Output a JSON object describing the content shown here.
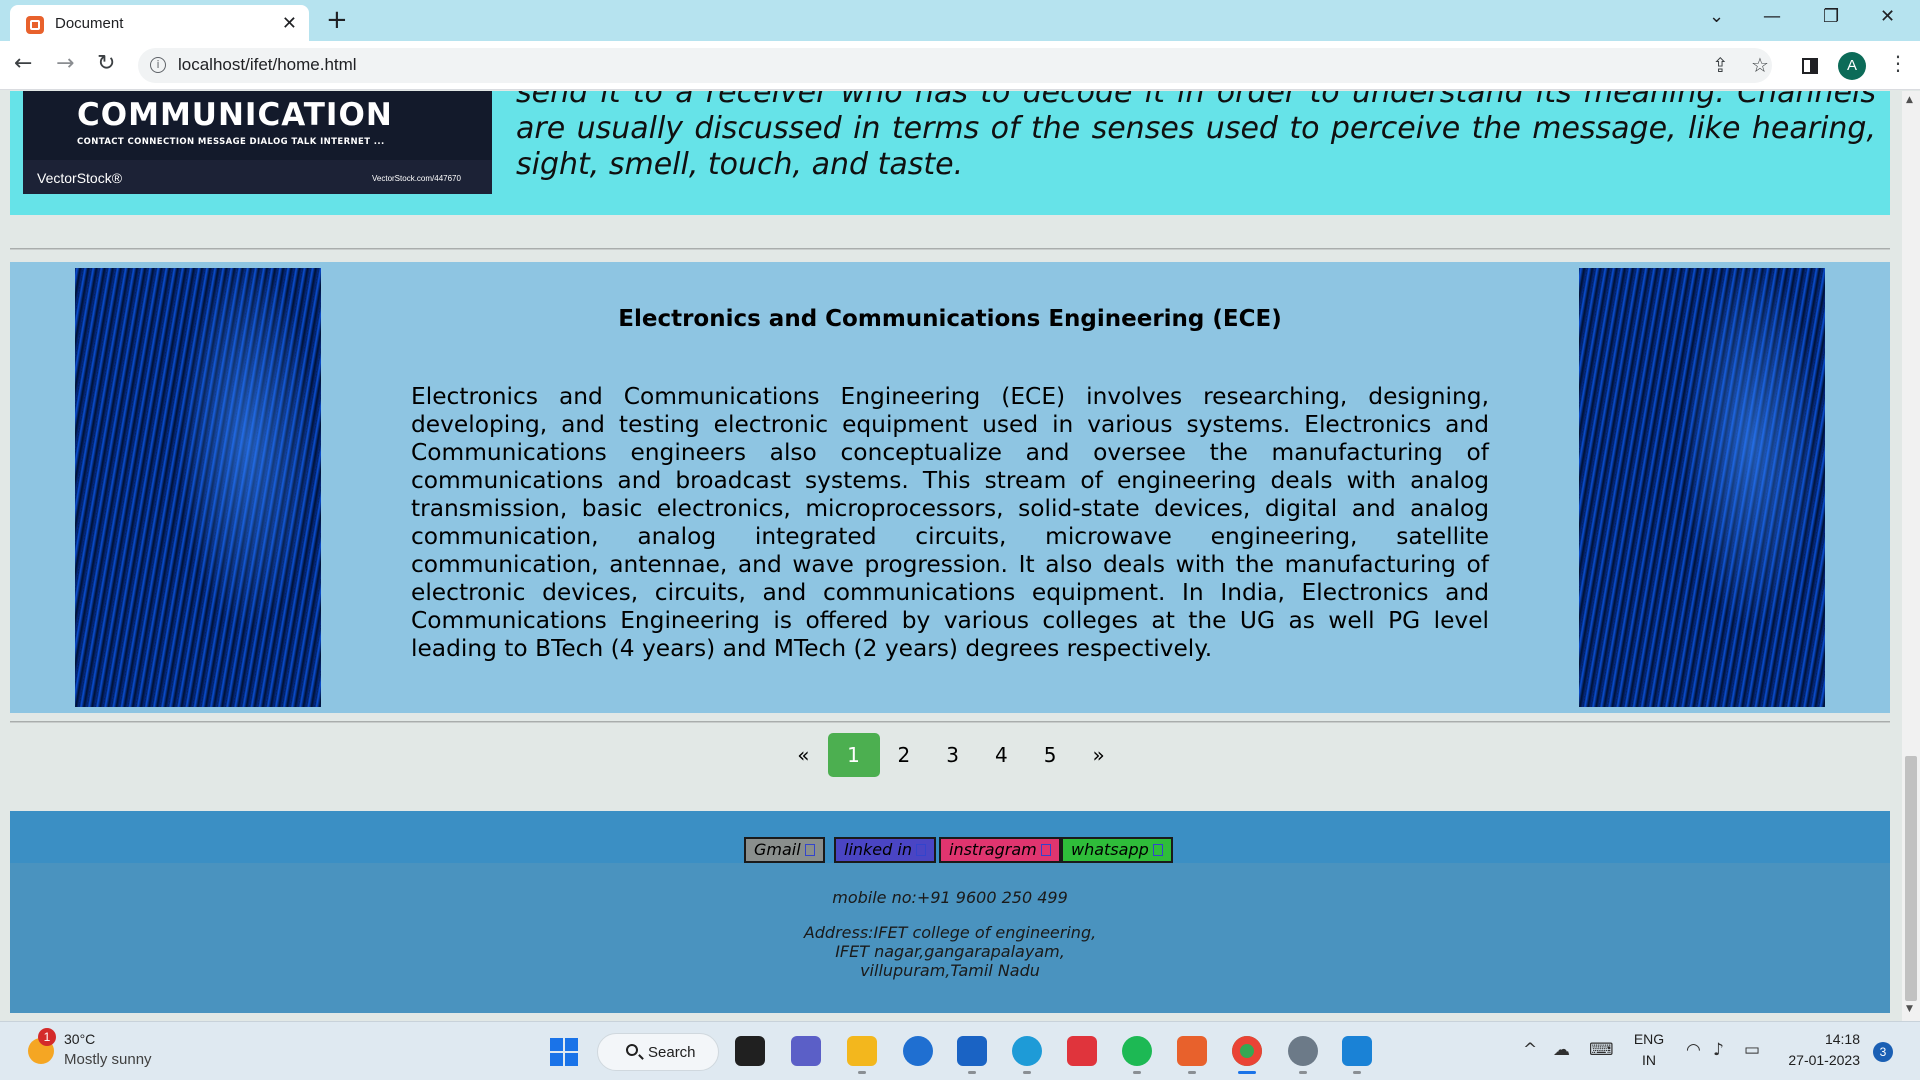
{
  "browser": {
    "tab_title": "Document",
    "tab_close": "✕",
    "new_tab": "+",
    "url": "localhost/ifet/home.html",
    "profile_initial": "A",
    "window_controls": [
      "⌄",
      "—",
      "❐",
      "✕"
    ]
  },
  "communication": {
    "image": {
      "title": "COMMUNICATION",
      "subtitle": "CONTACT  CONNECTION  MESSAGE  DIALOG  TALK  INTERNET ...",
      "brand": "VectorStock®",
      "id": "VectorStock.com/447670"
    },
    "text": "send it to a receiver who has to decode it in order to understand its meaning. Channels are usually discussed in terms of the senses used to perceive the message, like hearing, sight, smell, touch, and taste."
  },
  "ece": {
    "title": "Electronics and Communications Engineering (ECE)",
    "body": "Electronics and Communications Engineering (ECE) involves researching, designing, developing, and testing electronic equipment used in various systems. Electronics and Communications engineers also conceptualize and oversee the manufacturing of communications and broadcast systems. This stream of engineering deals with analog transmission, basic electronics, microprocessors, solid-state devices, digital and analog communication, analog integrated circuits, microwave engineering, satellite communication, antennae, and wave progression. It also deals with the manufacturing of electronic devices, circuits, and communications equipment. In India, Electronics and Communications Engineering is offered by various colleges at the UG as well PG level leading to BTech (4 years) and MTech (2 years) degrees respectively."
  },
  "pagination": {
    "prev": "«",
    "pages": [
      "1",
      "2",
      "3",
      "4",
      "5"
    ],
    "active": "1",
    "next": "»",
    "active_color": "#4caf50"
  },
  "footer": {
    "social": [
      {
        "label": "Gmail",
        "color": "#8a8f8d"
      },
      {
        "label": "linked in",
        "color": "#4a45c4"
      },
      {
        "label": "instragram",
        "color": "#e0356f"
      },
      {
        "label": "whatsapp",
        "color": "#2fbd3a"
      }
    ],
    "mobile": "mobile no:+91 9600 250 499",
    "address_lines": [
      "Address:IFET college of engineering,",
      "IFET nagar,gangarapalayam,",
      "villupuram,Tamil Nadu"
    ]
  },
  "taskbar": {
    "weather_badge": "1",
    "temperature": "30°C",
    "weather": "Mostly sunny",
    "search": "Search",
    "language": "ENG",
    "region": "IN",
    "time": "14:18",
    "date": "27-01-2023",
    "notifications": "3"
  }
}
